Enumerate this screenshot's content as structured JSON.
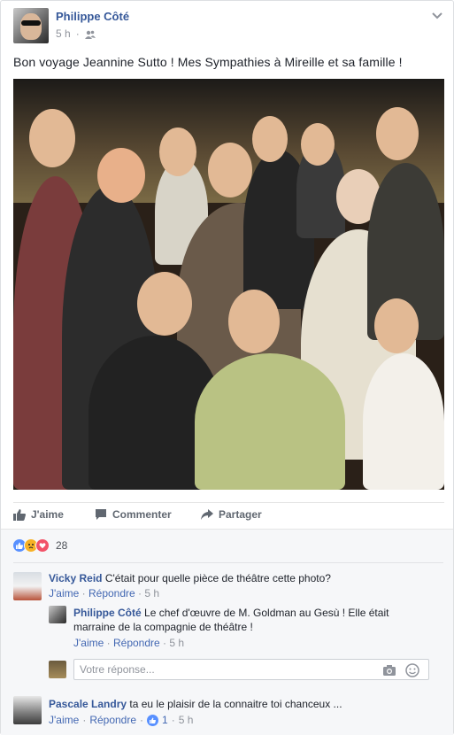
{
  "post": {
    "author": "Philippe Côté",
    "time": "5 h",
    "audience_icon": "friends-icon",
    "text": "Bon voyage Jeannine Sutto ! Mes Sympathies à Mireille et sa famille !"
  },
  "actions": {
    "like": "J'aime",
    "comment": "Commenter",
    "share": "Partager"
  },
  "reactions": {
    "icons": [
      "like",
      "sad",
      "love"
    ],
    "count": "28",
    "colors": {
      "like": "#5890ff",
      "sad": "#f7b125",
      "love": "#f25268"
    }
  },
  "comments": [
    {
      "author": "Vicky Reid",
      "text": "C'était pour quelle pièce de théâtre cette photo?",
      "like": "J'aime",
      "reply": "Répondre",
      "time": "5 h"
    },
    {
      "author": "Philippe Côté",
      "text": "Le chef d'œuvre de M. Goldman au Gesù ! Elle était marraine de la compagnie de théâtre !",
      "like": "J'aime",
      "reply": "Répondre",
      "time": "5 h"
    },
    {
      "author": "Pascale Landry",
      "text": "ta eu le plaisir de la connaitre toi chanceux ...",
      "like": "J'aime",
      "reply": "Répondre",
      "likes": "1",
      "time": "5 h"
    }
  ],
  "reply_input": {
    "placeholder": "Votre réponse..."
  },
  "colors": {
    "link": "#365899",
    "accent": "#4267b2",
    "muted": "#90949c"
  }
}
